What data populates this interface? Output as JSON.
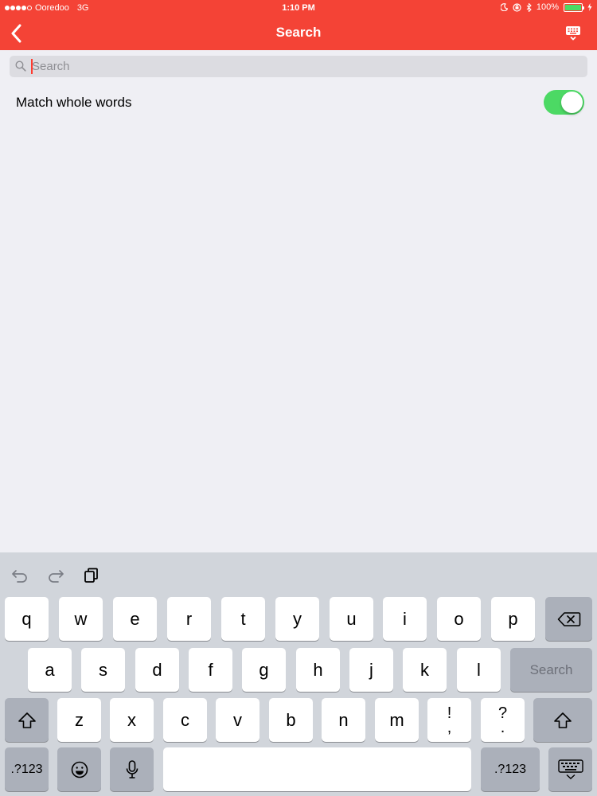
{
  "status_bar": {
    "carrier": "Ooredoo",
    "network": "3G",
    "time": "1:10 PM",
    "battery": "100%",
    "signal_bars": 4,
    "signal_max": 5,
    "battery_level": 1.0
  },
  "nav": {
    "title": "Search",
    "back_icon": "chevron-left-icon",
    "keyboard_icon": "keyboard-icon"
  },
  "search": {
    "placeholder": "Search",
    "value": ""
  },
  "options": {
    "match_whole_words_label": "Match whole words",
    "match_whole_words_on": true
  },
  "keyboard": {
    "tools": [
      "undo-icon",
      "redo-icon",
      "paste-icon"
    ],
    "row1": [
      "q",
      "w",
      "e",
      "r",
      "t",
      "y",
      "u",
      "i",
      "o",
      "p"
    ],
    "row2": [
      "a",
      "s",
      "d",
      "f",
      "g",
      "h",
      "j",
      "k",
      "l"
    ],
    "row3": [
      "z",
      "x",
      "c",
      "v",
      "b",
      "n",
      "m"
    ],
    "punct1_top": "!",
    "punct1_bottom": ",",
    "punct2_top": "?",
    "punct2_bottom": ".",
    "search_key": "Search",
    "numbers_key": ".?123",
    "numbers_key_right": ".?123"
  },
  "colors": {
    "nav_background": "#f44336",
    "toggle_on": "#4cd964",
    "page_background": "#efeff4",
    "keyboard_background": "#d1d5db"
  }
}
